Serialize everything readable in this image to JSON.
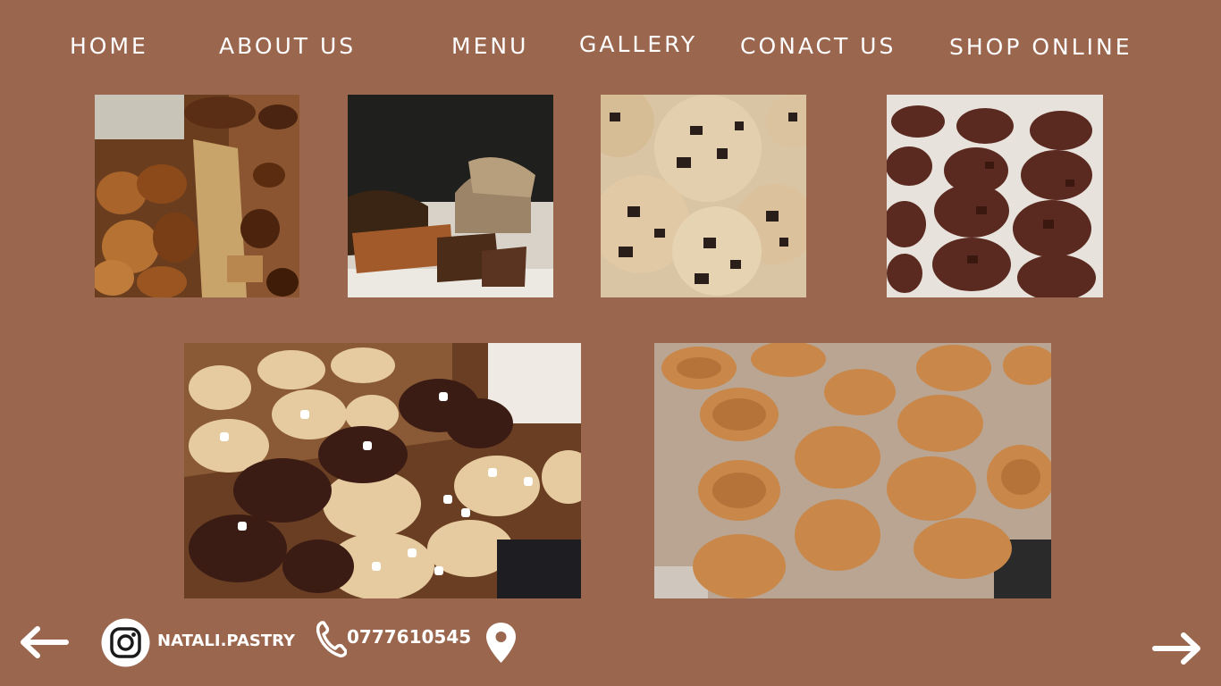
{
  "nav": {
    "home": "HOME",
    "about": "ABOUT US",
    "menu": "MENU",
    "gallery": "GALLERY",
    "contact": "CONACT US",
    "shop": "SHOP ONLINE"
  },
  "gallery": {
    "photos": [
      {
        "subject": "pastry-rolls-photo"
      },
      {
        "subject": "sourdough-bread-photo"
      },
      {
        "subject": "chocolate-chip-cookies-photo"
      },
      {
        "subject": "double-chocolate-cookies-photo"
      },
      {
        "subject": "marshmallow-cookies-photo"
      },
      {
        "subject": "oat-cookies-tray-photo"
      }
    ]
  },
  "footer": {
    "instagram_handle": "NATALI.PASTRY",
    "phone": "0777610545"
  },
  "icons": {
    "prev": "arrow-left-icon",
    "next": "arrow-right-icon",
    "instagram": "instagram-icon",
    "phone": "phone-icon",
    "location": "location-pin-icon"
  },
  "colors": {
    "background": "#9a664e",
    "text": "#ffffff"
  }
}
